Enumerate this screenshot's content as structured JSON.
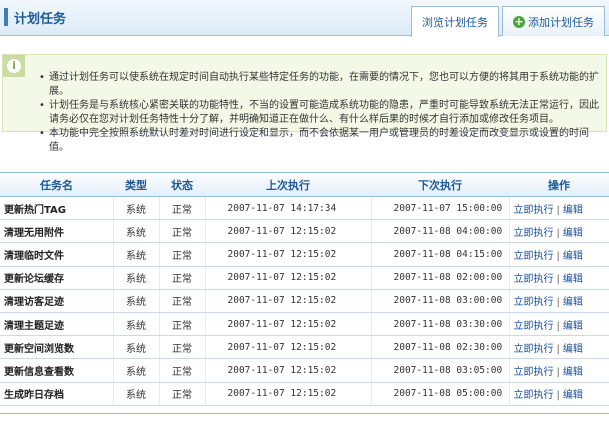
{
  "header": {
    "title": "计划任务",
    "tabs": [
      {
        "label": "浏览计划任务",
        "active": true
      },
      {
        "label": "添加计划任务",
        "icon": "plus-circle-icon",
        "active": false
      }
    ]
  },
  "info": {
    "icon": "info-icon",
    "items": [
      "通过计划任务可以使系统在规定时间自动执行某些特定任务的功能，在需要的情况下，您也可以方便的将其用于系统功能的扩展。",
      "计划任务是与系统核心紧密关联的功能特性，不当的设置可能造成系统功能的隐患，严重时可能导致系统无法正常运行，因此请务必仅在您对计划任务特性十分了解，并明确知道正在做什么、有什么样后果的时候才自行添加或修改任务项目。",
      "本功能中完全按照系统默认时差对时间进行设定和显示，而不会依据某一用户或管理员的时差设定而改变显示或设置的时间值。"
    ]
  },
  "table": {
    "columns": [
      "任务名",
      "类型",
      "状态",
      "上次执行",
      "下次执行",
      "操作"
    ],
    "op_run_label": "立即执行",
    "op_sep": "|",
    "op_edit_label": "编辑",
    "rows": [
      {
        "name": "更新热门TAG",
        "type": "系统",
        "status": "正常",
        "last": "2007-11-07 14:17:34",
        "next": "2007-11-07 15:00:00"
      },
      {
        "name": "清理无用附件",
        "type": "系统",
        "status": "正常",
        "last": "2007-11-07 12:15:02",
        "next": "2007-11-08 04:00:00"
      },
      {
        "name": "清理临时文件",
        "type": "系统",
        "status": "正常",
        "last": "2007-11-07 12:15:02",
        "next": "2007-11-08 04:15:00"
      },
      {
        "name": "更新论坛缓存",
        "type": "系统",
        "status": "正常",
        "last": "2007-11-07 12:15:02",
        "next": "2007-11-08 02:00:00"
      },
      {
        "name": "清理访客足迹",
        "type": "系统",
        "status": "正常",
        "last": "2007-11-07 12:15:02",
        "next": "2007-11-08 03:00:00"
      },
      {
        "name": "清理主题足迹",
        "type": "系统",
        "status": "正常",
        "last": "2007-11-07 12:15:02",
        "next": "2007-11-08 03:30:00"
      },
      {
        "name": "更新空间浏览数",
        "type": "系统",
        "status": "正常",
        "last": "2007-11-07 12:15:02",
        "next": "2007-11-08 02:30:00"
      },
      {
        "name": "更新信息查看数",
        "type": "系统",
        "status": "正常",
        "last": "2007-11-07 12:15:02",
        "next": "2007-11-08 03:05:00"
      },
      {
        "name": "生成昨日存档",
        "type": "系统",
        "status": "正常",
        "last": "2007-11-07 12:15:02",
        "next": "2007-11-08 05:00:00"
      }
    ]
  }
}
